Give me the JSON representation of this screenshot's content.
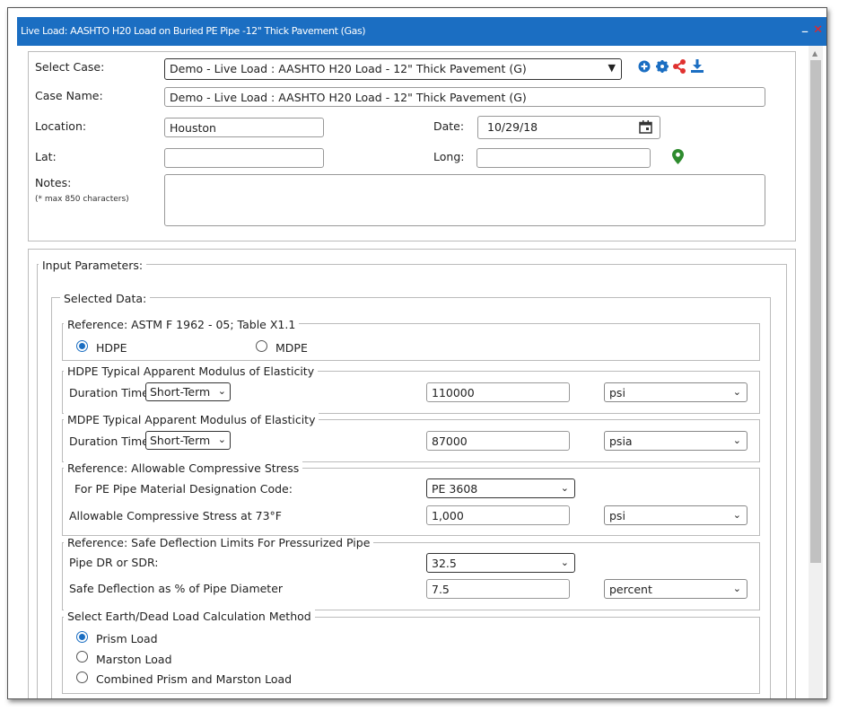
{
  "window": {
    "title": "Live Load: AASHTO H20 Load on Buried PE Pipe -12\" Thick Pavement (Gas)",
    "minimize": "–",
    "close": "✕"
  },
  "case": {
    "select_label": "Select Case:",
    "select_value": "Demo - Live Load : AASHTO H20 Load - 12\" Thick Pavement (G)",
    "name_label": "Case Name:",
    "name_value": "Demo - Live Load : AASHTO H20 Load - 12\" Thick Pavement (G)",
    "location_label": "Location:",
    "location_value": "Houston",
    "date_label": "Date:",
    "date_value": "10/29/18",
    "lat_label": "Lat:",
    "lat_value": "",
    "long_label": "Long:",
    "long_value": "",
    "notes_label": "Notes:",
    "notes_hint": "(* max 850 characters)",
    "notes_value": ""
  },
  "icons": {
    "add": "plus-circle-icon",
    "settings": "gear-icon",
    "share": "share-icon",
    "download": "download-icon",
    "map": "map-pin-icon",
    "calendar": "calendar-icon"
  },
  "colors": {
    "accent": "#1b6ec2",
    "share": "#e0312f",
    "pin": "#2e8b2e"
  },
  "input_parameters": {
    "legend": "Input Parameters:",
    "selected_data": "Selected Data:",
    "reference_astm": {
      "legend": "Reference: ASTM F 1962 - 05; Table X1.1",
      "options": [
        "HDPE",
        "MDPE"
      ],
      "selected": "HDPE"
    },
    "hdpe_modulus": {
      "legend": "HDPE Typical Apparent Modulus of Elasticity",
      "duration_label": "Duration Time",
      "duration_value": "Short-Term",
      "value": "110000",
      "unit": "psi"
    },
    "mdpe_modulus": {
      "legend": "MDPE Typical Apparent Modulus of Elasticity",
      "duration_label": "Duration Time",
      "duration_value": "Short-Term",
      "value": "87000",
      "unit": "psia"
    },
    "compressive_stress": {
      "legend": "Reference: Allowable Compressive Stress",
      "designation_label": "For PE Pipe Material Designation Code:",
      "designation_value": "PE 3608",
      "stress_label": "Allowable Compressive Stress at 73°F",
      "stress_value": "1,000",
      "stress_unit": "psi"
    },
    "deflection": {
      "legend": "Reference: Safe Deflection Limits For Pressurized Pipe",
      "dr_label": "Pipe DR or SDR:",
      "dr_value": "32.5",
      "safe_label": "Safe Deflection as % of Pipe Diameter",
      "safe_value": "7.5",
      "safe_unit": "percent"
    },
    "earth_load": {
      "legend": "Select Earth/Dead Load Calculation Method",
      "options": [
        "Prism Load",
        "Marston Load",
        "Combined Prism and Marston Load"
      ],
      "selected": "Prism Load"
    }
  }
}
